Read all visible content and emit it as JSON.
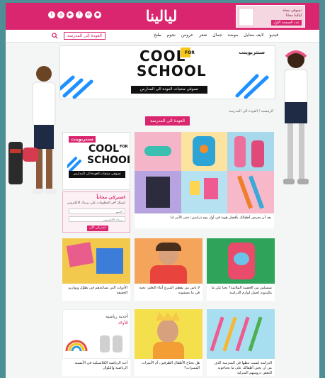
{
  "header": {
    "logo": "ليالينا",
    "social_icons": [
      "twitter-icon",
      "instagram-icon",
      "youtube-icon",
      "facebook-icon",
      "email-icon",
      "user-icon"
    ],
    "promo": {
      "line1": "تسوقي مجلة",
      "line2": "ليالينا مجانا",
      "button": "عدد الصفحة الأول"
    }
  },
  "nav": {
    "items": [
      "فيديو",
      "لايف ستايل",
      "موضة",
      "جمال",
      "شعر",
      "عروس",
      "نجوم",
      "طبخ"
    ],
    "active": "العودة إلى المدرسة",
    "search_icon": "search-icon"
  },
  "hero": {
    "brand": "سنتربوينت",
    "cool": "COOL",
    "for": "FOR",
    "school": "SCHOOL",
    "tagline": "تسوقي منتجات العودة الى المدارس"
  },
  "breadcrumb": "الرئيسية / العودة الى المدرسة",
  "section_title": "العودة الى المدرسة",
  "sidebar_ad": {
    "brand": "سنتربوينت",
    "cool": "COOL",
    "for": "FOR",
    "school": "SCHOOL",
    "tagline": "تسوقي منتجات العودة الى المدارس"
  },
  "subscribe": {
    "title": "اشتركي مجاناً",
    "desc": "لتصلك آخر المعلومات على بريدك الالكتروني",
    "name_placeholder": "الاسم",
    "email_placeholder": "بريدك الالكتروني",
    "button": "اشتركي الآن"
  },
  "featured": {
    "caption": "يعد أن يحرص أطفالك بأفضل هوية في أول يوم دراسي: حتى الأمر لنا"
  },
  "articles": [
    {
      "caption": "الأدوات التي تساعدهم في تطوّل ونوازيم الحقيقة"
    },
    {
      "caption": "لا ياس من يقطي المبرع أثناء التعلم: نجية في ما يعيشونه"
    },
    {
      "caption": "تمسكين من الحقيبة الملائمة؟ تحيا تكن ما يكليدونه لحمل لوازم الدراسة"
    },
    {
      "caption": "أذية الرياضية الكلاسيكية في الأمسية الرياضية والتلوال"
    },
    {
      "caption": "هل يحتاج الأطفال الظرفين، آم الأميرات المميزات؟"
    },
    {
      "caption": "الدراسة ليست مطها في المدرسة الذي من أن يحين أطفالك على ما يحتاجونه للتفض دروسهم المنزلية"
    }
  ],
  "extra_ad": {
    "title": "أحذية رياضية",
    "subtitle": "للأولاد"
  },
  "colors": {
    "brand": "#d9266e",
    "frame_bg": "#4d8f95",
    "page_bg": "#f4f6f6"
  }
}
